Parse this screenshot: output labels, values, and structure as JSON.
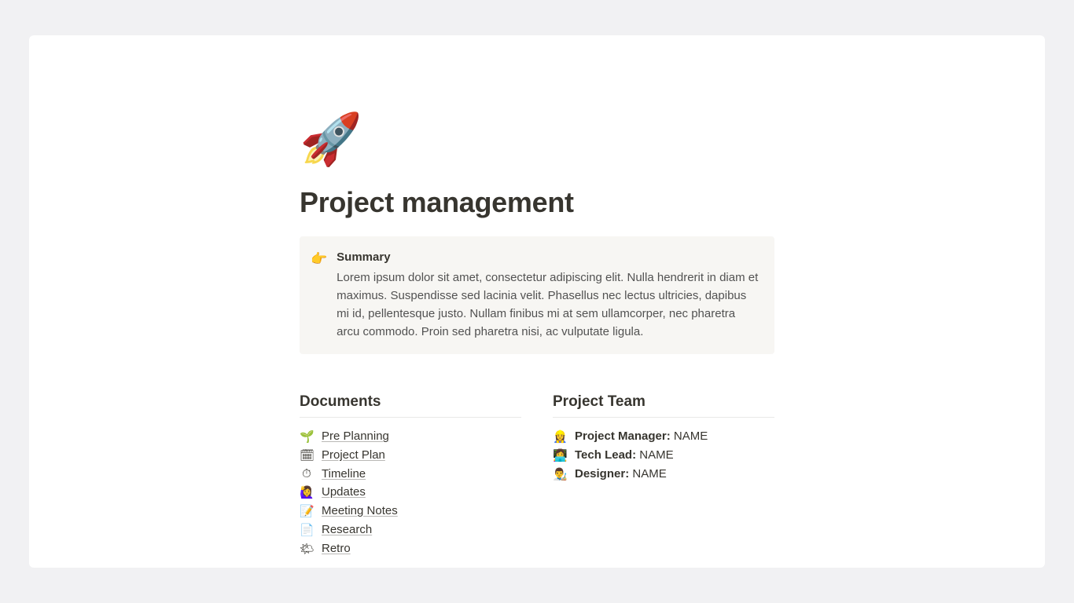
{
  "page": {
    "icon": "🚀",
    "title": "Project management"
  },
  "summary": {
    "icon": "👉",
    "heading": "Summary",
    "text": "Lorem ipsum dolor sit amet, consectetur adipiscing elit. Nulla hendrerit in diam et maximus. Suspendisse sed lacinia velit. Phasellus nec lectus ultricies, dapibus mi id, pellentesque justo. Nullam finibus mi at sem ullamcorper, nec pharetra arcu commodo. Proin sed pharetra nisi, ac vulputate ligula."
  },
  "documents": {
    "heading": "Documents",
    "items": [
      {
        "icon": "🌱",
        "label": "Pre Planning"
      },
      {
        "icon": "🗓",
        "label": "Project Plan"
      },
      {
        "icon": "⏱",
        "label": "Timeline"
      },
      {
        "icon": "🙋‍♀️",
        "label": "Updates"
      },
      {
        "icon": "📝",
        "label": "Meeting Notes"
      },
      {
        "icon": "📄",
        "label": "Research"
      },
      {
        "icon": "🌤",
        "label": "Retro"
      }
    ]
  },
  "team": {
    "heading": "Project Team",
    "items": [
      {
        "icon": "👷‍♀️",
        "role": "Project Manager:",
        "name": "NAME"
      },
      {
        "icon": "👩‍💻",
        "role": "Tech Lead:",
        "name": "NAME"
      },
      {
        "icon": "👨‍🎨",
        "role": "Designer:",
        "name": "NAME"
      }
    ]
  }
}
